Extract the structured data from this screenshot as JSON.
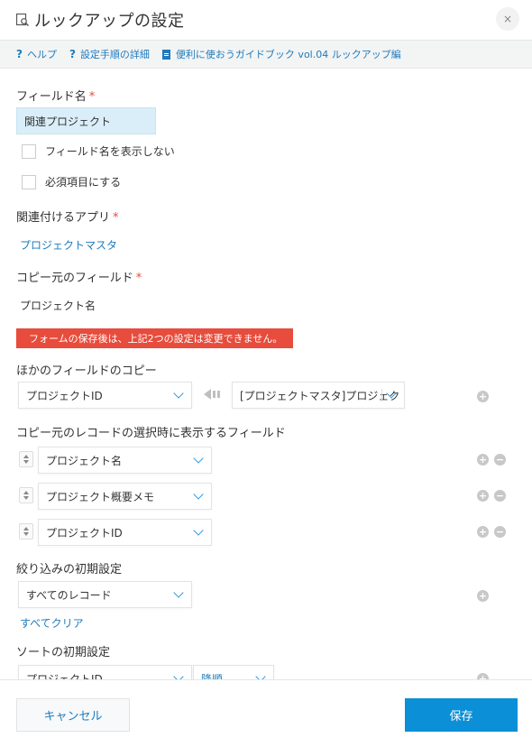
{
  "header": {
    "title": "ルックアップの設定",
    "close_label": "×"
  },
  "helpbar": {
    "help": "ヘルプ",
    "steps": "設定手順の詳細",
    "guide": "便利に使おうガイドブック vol.04 ルックアップ編"
  },
  "field_name": {
    "label": "フィールド名",
    "required_mark": "*",
    "value": "関連プロジェクト",
    "hide_label": "フィールド名を表示しない",
    "required_label": "必須項目にする"
  },
  "related_app": {
    "label": "関連付けるアプリ",
    "required_mark": "*",
    "value": "プロジェクトマスタ"
  },
  "source_field": {
    "label": "コピー元のフィールド",
    "required_mark": "*",
    "value": "プロジェクト名"
  },
  "warning": "フォームの保存後は、上記2つの設定は変更できません。",
  "copy_fields": {
    "label": "ほかのフィールドのコピー",
    "from_value": "プロジェクトID",
    "to_value": "[プロジェクトマスタ]プロジェク"
  },
  "display_fields": {
    "label": "コピー元のレコードの選択時に表示するフィールド",
    "items": [
      "プロジェクト名",
      "プロジェクト概要メモ",
      "プロジェクトID"
    ]
  },
  "filter": {
    "label": "絞り込みの初期設定",
    "value": "すべてのレコード",
    "clear_label": "すべてクリア"
  },
  "sort": {
    "label": "ソートの初期設定",
    "field_value": "プロジェクトID",
    "order_value": "降順"
  },
  "footer": {
    "cancel": "キャンセル",
    "save": "保存"
  },
  "colors": {
    "accent": "#1e7bbd",
    "primary_button": "#0b8fd6",
    "warning": "#e74c3c",
    "required": "#e74c3c"
  }
}
